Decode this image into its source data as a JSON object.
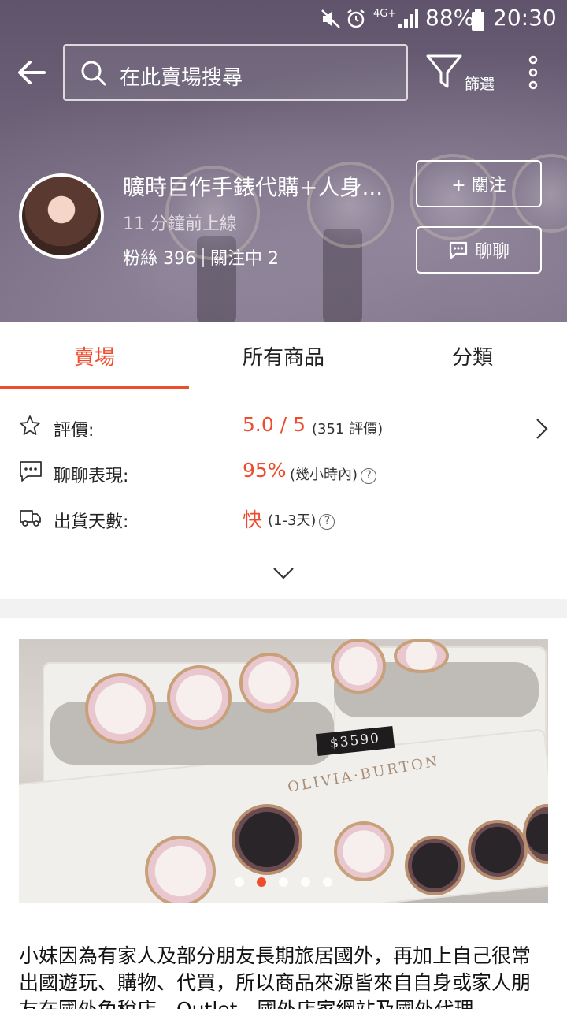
{
  "status_bar": {
    "battery": "88%",
    "time": "20:30",
    "network": "4G+"
  },
  "search": {
    "placeholder": "在此賣場搜尋"
  },
  "filter": {
    "label": "篩選"
  },
  "shop": {
    "name": "曠時巨作手錶代購+人身...",
    "last_online": "11 分鐘前上線",
    "followers_label": "粉絲 396",
    "following_label": "關注中 2"
  },
  "buttons": {
    "follow": "+ 關注",
    "chat": "聊聊"
  },
  "tabs": [
    {
      "label": "賣場",
      "active": true
    },
    {
      "label": "所有商品",
      "active": false
    },
    {
      "label": "分類",
      "active": false
    }
  ],
  "ratings": {
    "rating_label": "評價:",
    "rating_value": "5.0 / 5",
    "rating_count": "(351 評價)",
    "chat_label": "聊聊表現:",
    "chat_value": "95%",
    "chat_extra": "(幾小時內)",
    "ship_label": "出貨天數:",
    "ship_value": "快",
    "ship_extra": "(1-3天)"
  },
  "banner": {
    "price_tag": "$3590",
    "brand": "OLIVIA·BURTON",
    "slide_count": 5,
    "active_slide": 2
  },
  "description": "小妹因為有家人及部分朋友長期旅居國外，再加上自己很常出國遊玩、購物、代買，所以商品來源皆來自自身或家人朋友在國外免稅店、Outlet、國外店家網站及國外代理",
  "colors": {
    "accent": "#ee4d2d",
    "header_bg": "#6e6379"
  },
  "icons": [
    "back-arrow-icon",
    "search-icon",
    "filter-icon",
    "more-vert-icon",
    "star-icon",
    "chat-bubble-icon",
    "truck-icon",
    "chevron-right-icon",
    "chevron-down-icon",
    "help-icon"
  ]
}
